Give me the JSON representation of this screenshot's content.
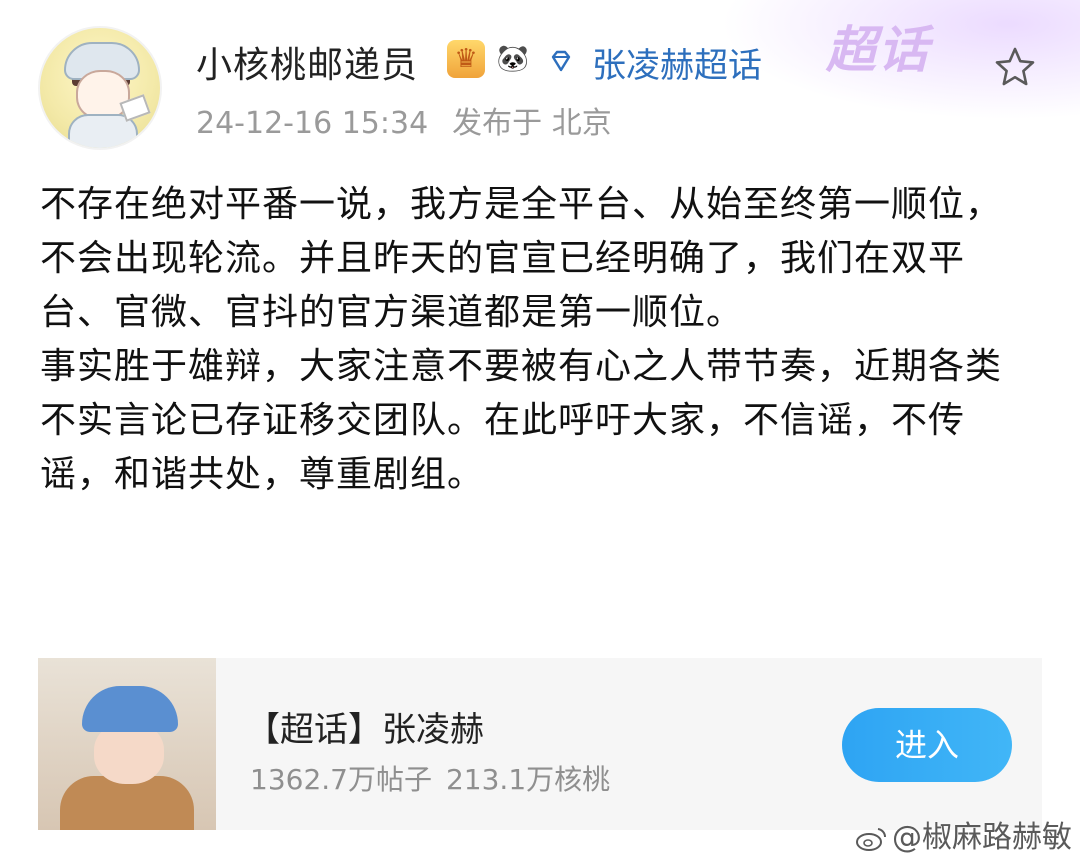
{
  "header": {
    "username": "小核桃邮递员",
    "supertopic_link": "张凌赫超话",
    "chaohua_logo": "超话",
    "timestamp": "24-12-16 15:34",
    "location": "发布于 北京"
  },
  "post": {
    "paragraphs": [
      "不存在绝对平番一说，我方是全平台、从始至终第一顺位，不会出现轮流。并且昨天的官宣已经明确了，我们在双平台、官微、官抖的官方渠道都是第一顺位。",
      "事实胜于雄辩，大家注意不要被有心之人带节奏，近期各类不实言论已存证移交团队。在此呼吁大家，不信谣，不传谣，和谐共处，尊重剧组。"
    ]
  },
  "card": {
    "title": "【超话】张凌赫",
    "posts_count": "1362.7万帖子",
    "walnuts_count": "213.1万核桃",
    "enter_label": "进入"
  },
  "watermark": {
    "text": "@椒麻路赫敏"
  },
  "icons": {
    "crown_badge": "crown-icon",
    "panda_badge": "panda-icon",
    "diamond": "diamond-icon",
    "favorite": "star-outline-icon",
    "watermark_logo": "weibo-icon"
  },
  "colors": {
    "link": "#2d6fbd",
    "enter_button": "#2ea4f3",
    "meta_text": "#9a9a9a"
  }
}
